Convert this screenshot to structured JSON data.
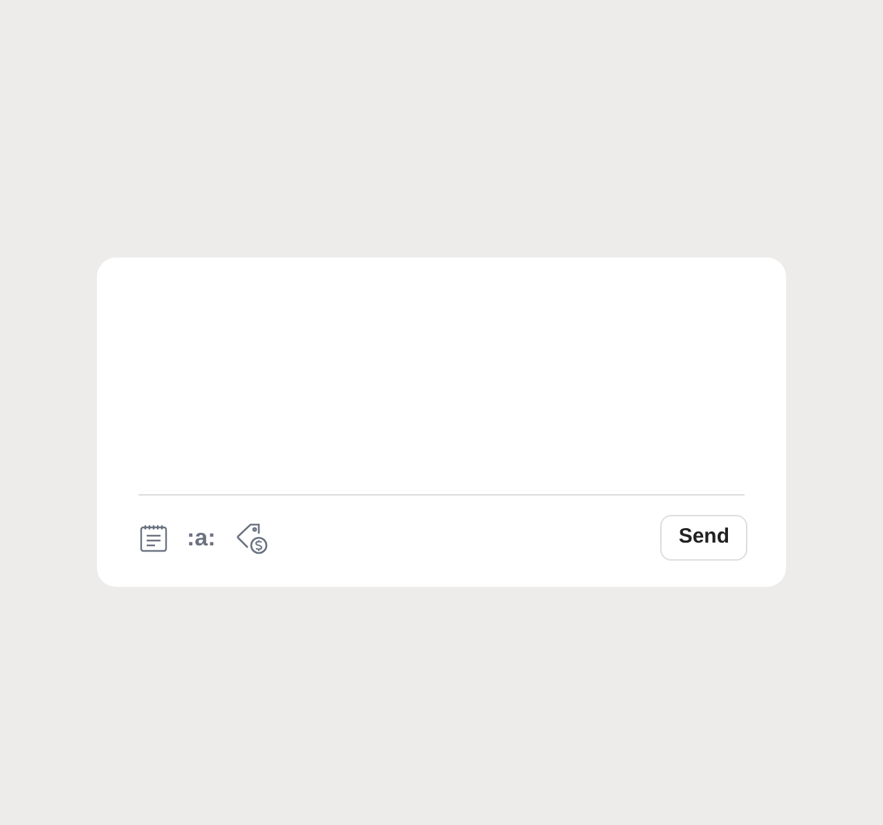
{
  "composer": {
    "emoji_button": ":a:",
    "send_button": "Send"
  }
}
